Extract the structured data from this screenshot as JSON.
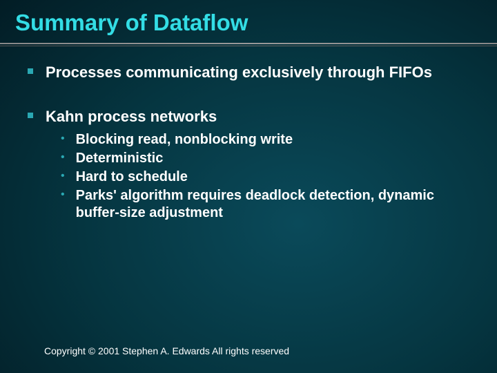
{
  "title": "Summary of Dataflow",
  "bullets": {
    "top": "Processes communicating exclusively through FIFOs",
    "section": {
      "heading": "Kahn process networks",
      "items": [
        "Blocking read, nonblocking write",
        "Deterministic",
        "Hard to schedule",
        "Parks' algorithm requires deadlock detection, dynamic buffer-size adjustment"
      ]
    }
  },
  "footer": "Copyright © 2001 Stephen A. Edwards  All rights reserved"
}
